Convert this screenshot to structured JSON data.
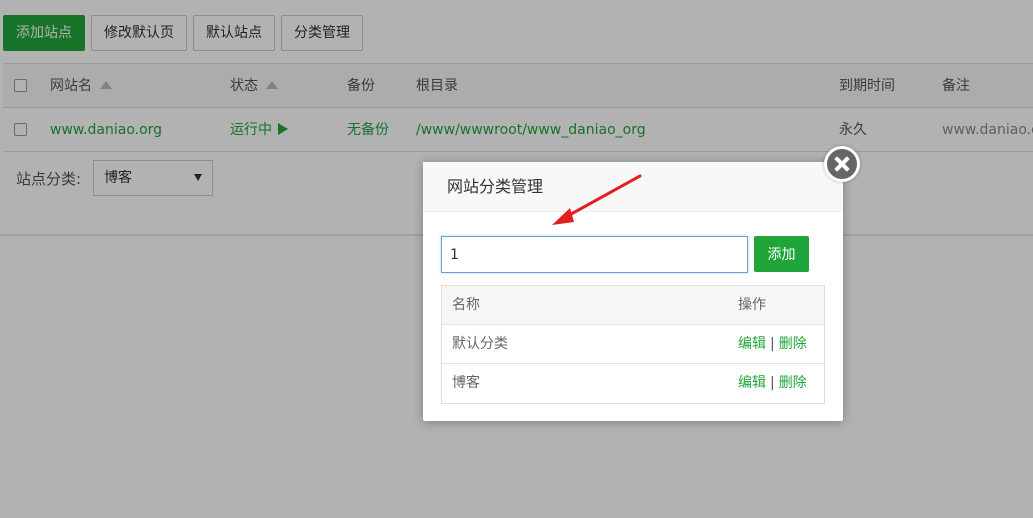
{
  "toolbar": {
    "add_site": "添加站点",
    "edit_default_page": "修改默认页",
    "default_site": "默认站点",
    "category_manage": "分类管理"
  },
  "site_table": {
    "headers": {
      "site_name": "网站名",
      "status": "状态",
      "backup": "备份",
      "root": "根目录",
      "expire": "到期时间",
      "note": "备注"
    },
    "rows": [
      {
        "site_name": "www.daniao.org",
        "status": "运行中",
        "backup": "无备份",
        "root": "/www/wwwroot/www_daniao_org",
        "expire": "永久",
        "note": "www.daniao.o"
      }
    ]
  },
  "category_filter": {
    "label": "站点分类:",
    "selected": "博客"
  },
  "modal": {
    "title": "网站分类管理",
    "input_value": "1",
    "add_button": "添加",
    "table_headers": {
      "name": "名称",
      "action": "操作"
    },
    "rows": [
      {
        "name": "默认分类",
        "edit": "编辑",
        "sep": "|",
        "delete": "删除"
      },
      {
        "name": "博客",
        "edit": "编辑",
        "sep": "|",
        "delete": "删除"
      }
    ]
  },
  "colors": {
    "accent": "#20a53a",
    "annotation_arrow": "#e02020"
  }
}
